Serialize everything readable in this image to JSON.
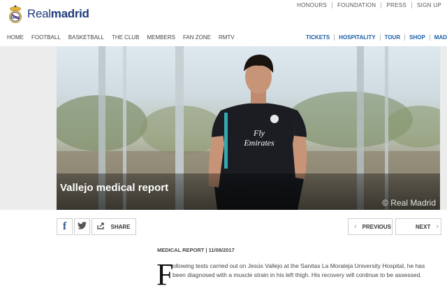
{
  "header": {
    "brand_prefix": "Real",
    "brand_suffix": "madrid",
    "utility_links": [
      "HONOURS",
      "FOUNDATION",
      "PRESS",
      "SIGN UP"
    ]
  },
  "nav": {
    "left": [
      "HOME",
      "FOOTBALL",
      "BASKETBALL",
      "THE CLUB",
      "MEMBERS",
      "FAN ZONE",
      "RMTV"
    ],
    "right": [
      "TICKETS",
      "HOSPITALITY",
      "TOUR",
      "SHOP",
      "MAD"
    ]
  },
  "hero": {
    "title": "Vallejo medical report",
    "watermark": "© Real Madrid",
    "shirt_sponsor_line1": "Fly",
    "shirt_sponsor_line2": "Emirates"
  },
  "share": {
    "facebook_icon": "f",
    "share_label": "SHARE"
  },
  "pager": {
    "previous_label": "PREVIOUS",
    "next_label": "NEXT"
  },
  "article": {
    "meta": "MEDICAL REPORT | 11/08/2017",
    "dropcap": "F",
    "body": "ollowing tests carried out on Jesús Vallejo at the Sanitas La Moraleja University Hospital, he has been diagnosed with a muscle strain in his left thigh. His recovery will continue to be assessed."
  },
  "colors": {
    "brand_blue": "#1d3b7a",
    "link_blue": "#1d5fa6",
    "kit_black": "#1b1d22",
    "kit_accent": "#37c1c9"
  }
}
